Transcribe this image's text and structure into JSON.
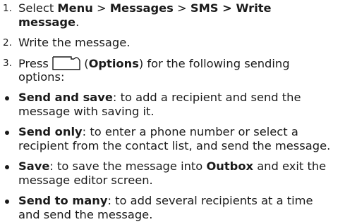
{
  "steps": [
    {
      "num": "1.",
      "parts": [
        {
          "text": "Select ",
          "bold": false
        },
        {
          "text": "Menu",
          "bold": true
        },
        {
          "text": " > ",
          "bold": false
        },
        {
          "text": "Messages",
          "bold": true
        },
        {
          "text": " > ",
          "bold": false
        },
        {
          "text": "SMS > Write",
          "bold": true
        }
      ],
      "cont": [
        {
          "text": "message",
          "bold": true
        },
        {
          "text": ".",
          "bold": false
        }
      ]
    },
    {
      "num": "2.",
      "text": "Write the message."
    },
    {
      "num": "3.",
      "pre": "Press ",
      "icon": "options-softkey-icon",
      "mid": " (",
      "bold": "Options",
      "post": ") for the following sending",
      "cont": "options:"
    }
  ],
  "options": [
    {
      "term": "Send and save",
      "line1": ": to add a recipient and send the",
      "line2": "message with saving it."
    },
    {
      "term": "Send only",
      "line1": ": to enter a phone number or select a",
      "line2": "recipient from the contact list, and send the message."
    },
    {
      "term": "Save",
      "line1a": ": to save the message into ",
      "line1b": "Outbox",
      "line1c": " and exit the",
      "line2": "message editor screen."
    },
    {
      "term": "Send to many",
      "line1": ": to add several recipients at a time",
      "line2": "and send the message."
    }
  ]
}
